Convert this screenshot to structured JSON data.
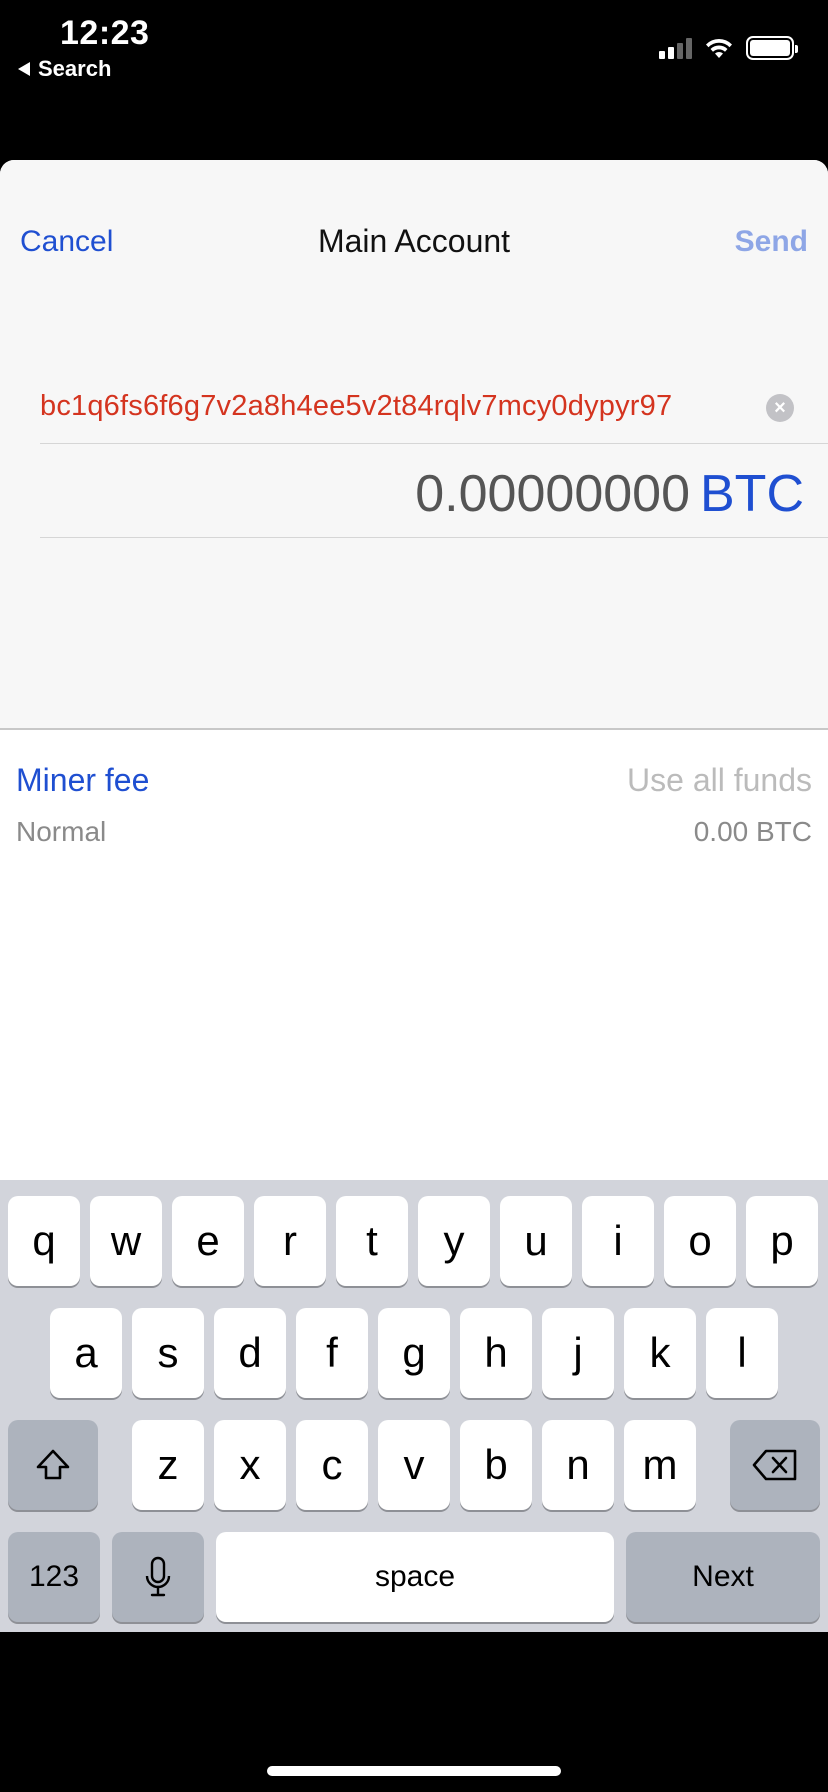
{
  "status_bar": {
    "time": "12:23",
    "back_label": "Search",
    "icons": [
      "signal-icon",
      "wifi-icon",
      "battery-icon"
    ]
  },
  "nav": {
    "cancel_label": "Cancel",
    "title": "Main Account",
    "send_label": "Send"
  },
  "form": {
    "address": "bc1q6fs6f6g7v2a8h4ee5v2t84rqlv7mcy0dypyr97",
    "amount": "0.00000000",
    "amount_unit": "BTC"
  },
  "fee": {
    "label": "Miner fee",
    "use_all_label": "Use all funds",
    "speed": "Normal",
    "amount": "0.00 BTC"
  },
  "keyboard": {
    "row1": [
      "q",
      "w",
      "e",
      "r",
      "t",
      "y",
      "u",
      "i",
      "o",
      "p"
    ],
    "row2": [
      "a",
      "s",
      "d",
      "f",
      "g",
      "h",
      "j",
      "k",
      "l"
    ],
    "row3": [
      "z",
      "x",
      "c",
      "v",
      "b",
      "n",
      "m"
    ],
    "numbers_label": "123",
    "space_label": "space",
    "next_label": "Next"
  },
  "colors": {
    "accent": "#1f4fd1",
    "address_error": "#d4341f",
    "send_disabled": "#8ea6e6"
  }
}
